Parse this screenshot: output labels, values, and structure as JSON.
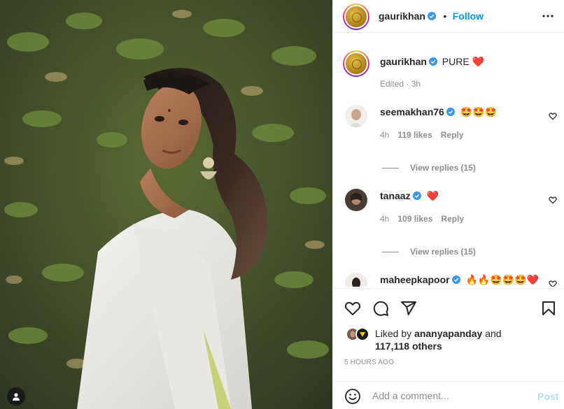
{
  "photo": {
    "icons": {
      "tag": "user-tag-icon"
    }
  },
  "header": {
    "username": "gaurikhan",
    "separator": "•",
    "follow_label": "Follow",
    "more_icon": "more-horizontal-icon"
  },
  "caption": {
    "username": "gaurikhan",
    "text": "PURE",
    "emoji": "❤️",
    "meta": "Edited · 3h"
  },
  "comments": [
    {
      "username": "seemakhan76",
      "text": "🤩🤩🤩",
      "time": "4h",
      "likes": "119 likes",
      "reply": "Reply",
      "view_replies": "View replies (15)"
    },
    {
      "username": "tanaaz",
      "text": "❤️",
      "time": "4h",
      "likes": "109 likes",
      "reply": "Reply",
      "view_replies": "View replies (15)"
    },
    {
      "username": "maheepkapoor",
      "text": "🔥🔥🤩🤩🤩❤️"
    }
  ],
  "actions": {
    "like": "heart-icon",
    "comment": "comment-icon",
    "share": "send-icon",
    "save": "bookmark-icon"
  },
  "likes": {
    "prefix": "Liked by",
    "user": "ananyapanday",
    "and": "and",
    "others": "117,118 others"
  },
  "timestamp": "5 HOURS AGO",
  "comment_box": {
    "placeholder": "Add a comment...",
    "post_label": "Post",
    "emoji_icon": "smiley-icon"
  },
  "colors": {
    "accent": "#0095f6",
    "verified": "#3897f0",
    "post_disabled": "#b2dffc",
    "muted": "#8e8e8e"
  }
}
